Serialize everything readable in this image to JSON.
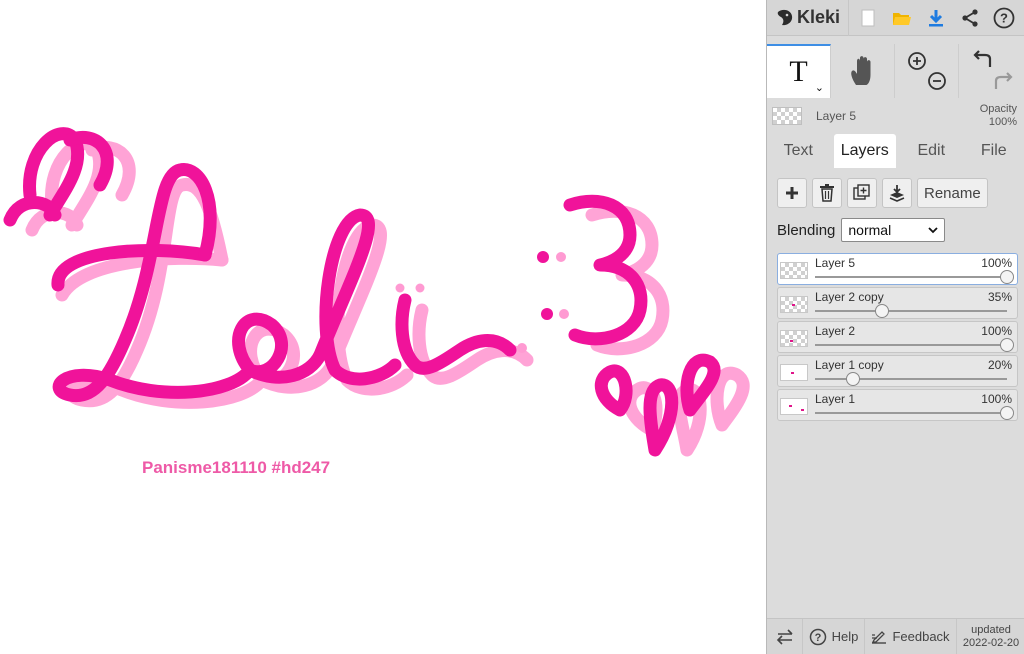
{
  "app": {
    "name": "Kleki"
  },
  "canvas": {
    "watermark": "Panisme181110 #hd247",
    "artwork_text": "Loli :3",
    "colors": {
      "primary": "#f0139a",
      "shadow": "#ff9ad2",
      "watermark": "#ee5aa7"
    }
  },
  "topbar": {
    "icons": [
      "new-image-icon",
      "open-folder-icon",
      "download-icon",
      "share-icon",
      "help-icon"
    ]
  },
  "tools": {
    "text_tool_label": "T",
    "caret": "⌄",
    "icons": [
      "text-tool-icon",
      "hand-tool-icon",
      "zoom-in-icon",
      "zoom-out-icon",
      "undo-icon",
      "redo-icon"
    ]
  },
  "current_layer": {
    "name": "Layer 5",
    "opacity_label": "Opacity",
    "opacity_value": "100%"
  },
  "tabs": [
    {
      "label": "Text",
      "active": false
    },
    {
      "label": "Layers",
      "active": true
    },
    {
      "label": "Edit",
      "active": false
    },
    {
      "label": "File",
      "active": false
    }
  ],
  "layer_actions": {
    "rename_label": "Rename",
    "icons": [
      "add-layer-icon",
      "delete-layer-icon",
      "duplicate-layer-icon",
      "merge-down-icon"
    ]
  },
  "blending": {
    "label": "Blending",
    "value": "normal"
  },
  "layers": [
    {
      "name": "Layer 5",
      "opacity": "100%",
      "level": 1.0,
      "selected": true
    },
    {
      "name": "Layer 2 copy",
      "opacity": "35%",
      "level": 0.35,
      "selected": false
    },
    {
      "name": "Layer 2",
      "opacity": "100%",
      "level": 1.0,
      "selected": false
    },
    {
      "name": "Layer 1 copy",
      "opacity": "20%",
      "level": 0.2,
      "selected": false
    },
    {
      "name": "Layer 1",
      "opacity": "100%",
      "level": 1.0,
      "selected": false
    }
  ],
  "footer": {
    "help_label": "Help",
    "feedback_label": "Feedback",
    "updated_label": "updated",
    "updated_date": "2022-02-20"
  }
}
